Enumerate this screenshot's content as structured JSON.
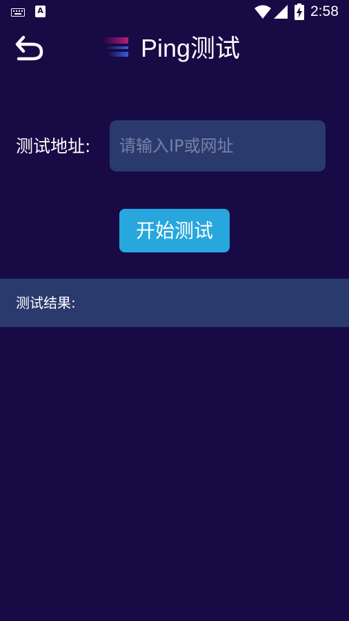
{
  "status_bar": {
    "time": "2:58",
    "notification_badge": "A",
    "icons": [
      "keyboard-icon",
      "app-notification-icon",
      "wifi-icon",
      "signal-icon",
      "battery-charging-icon"
    ]
  },
  "header": {
    "title": "Ping测试",
    "back_icon": "back-arrow-icon",
    "logo_colors": [
      "#c0197a",
      "#3a5fd6"
    ]
  },
  "form": {
    "address_label": "测试地址:",
    "address_value": "",
    "address_placeholder": "请输入IP或网址",
    "start_button_label": "开始测试"
  },
  "result": {
    "label": "测试结果:",
    "output": ""
  },
  "colors": {
    "background": "#170a45",
    "panel": "#2b3a6d",
    "button": "#28a6de",
    "placeholder": "#7780a9",
    "text": "#ffffff"
  }
}
